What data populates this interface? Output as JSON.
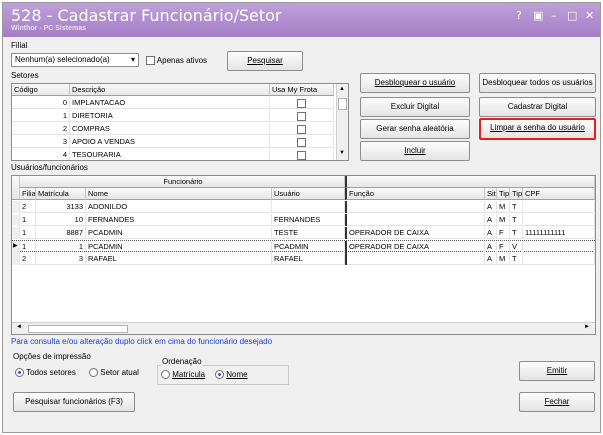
{
  "window": {
    "title": "528 - Cadastrar Funcionário/Setor",
    "subtitle": "Winthor - PC Sistemas",
    "controls": [
      "?",
      "▣",
      "–",
      "□",
      "✕"
    ]
  },
  "filial": {
    "label": "Filial",
    "value": "Nenhum(a) selecionado(a)",
    "apenas_ativos": "Apenas ativos",
    "pesquisar": "Pesquisar"
  },
  "setores": {
    "label": "Setores",
    "columns": [
      "Código",
      "Descrição",
      "Usa My Frota"
    ],
    "rows": [
      {
        "codigo": "0",
        "descricao": "IMPLANTACAO"
      },
      {
        "codigo": "1",
        "descricao": "DIRETORIA"
      },
      {
        "codigo": "2",
        "descricao": "COMPRAS"
      },
      {
        "codigo": "3",
        "descricao": "APOIO A VENDAS"
      },
      {
        "codigo": "4",
        "descricao": "TESOURARIA"
      }
    ]
  },
  "actions": {
    "desbloquear_usuario": "Desbloquear o usuário",
    "desbloquear_todos": "Desbloquear todos os usuários",
    "excluir_digital": "Excluir Digital",
    "cadastrar_digital": "Cadastrar Digital",
    "gerar_senha": "Gerar senha aleatória",
    "limpar_senha": "Limpar a senha do usuário",
    "incluir": "Incluir"
  },
  "usuarios": {
    "label": "Usuários/funcionários",
    "group_header": "Funcionário",
    "columns": [
      "Filial",
      "Matrícula",
      "Nome",
      "Usuário",
      "Função",
      "Situação",
      "Tipo",
      "Tipo",
      "CPF"
    ],
    "rows": [
      {
        "filial": "2",
        "matricula": "3133",
        "nome": "ADONILDO",
        "usuario": "",
        "funcao": "",
        "sit": "A",
        "tip1": "M",
        "tip2": "T",
        "cpf": ""
      },
      {
        "filial": "1",
        "matricula": "10",
        "nome": "FERNANDES",
        "usuario": "FERNANDES",
        "funcao": "",
        "sit": "A",
        "tip1": "M",
        "tip2": "T",
        "cpf": ""
      },
      {
        "filial": "1",
        "matricula": "8887",
        "nome": "PCADMIN",
        "usuario": "TESTE",
        "funcao": "OPERADOR DE CAIXA",
        "sit": "A",
        "tip1": "F",
        "tip2": "T",
        "cpf": "11111111111"
      },
      {
        "filial": "1",
        "matricula": "1",
        "nome": "PCADMIN",
        "usuario": "PCADMIN",
        "funcao": "OPERADOR DE CAIXA",
        "sit": "A",
        "tip1": "F",
        "tip2": "V",
        "cpf": ""
      },
      {
        "filial": "2",
        "matricula": "3",
        "nome": "RAFAEL",
        "usuario": "RAFAEL",
        "funcao": "",
        "sit": "A",
        "tip1": "M",
        "tip2": "T",
        "cpf": ""
      }
    ],
    "hint": "Para consulta e/ou alteração duplo click em cima do funcionário desejado"
  },
  "impressao": {
    "label": "Opções de impressão",
    "todos_setores": "Todos setores",
    "setor_atual": "Setor atual",
    "ordenacao_label": "Ordenação",
    "matricula": "Matrícula",
    "nome": "Nome"
  },
  "footer": {
    "pesquisar_funcionarios": "Pesquisar funcionários (F3)",
    "emitir": "Emitir",
    "fechar": "Fechar"
  },
  "colors": {
    "title_bar": "#a47dc7",
    "highlight": "#e02020",
    "hint": "#1a3fd0"
  }
}
